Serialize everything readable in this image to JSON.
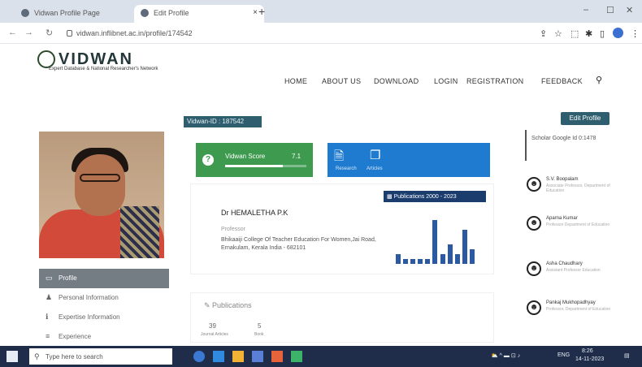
{
  "browser": {
    "tabs": [
      {
        "title": "Vidwan Profile Page",
        "active": false
      },
      {
        "title": "Edit Profile",
        "active": true
      }
    ],
    "new_tab_icon": "plus-icon",
    "url": "vidwan.inflibnet.ac.in/profile/174542"
  },
  "site": {
    "logo_text": "VIDWAN",
    "tagline": "Expert Database & National Researcher's Network",
    "menu": [
      "HOME",
      "ABOUT US",
      "DOWNLOAD",
      "LOGIN",
      "REGISTRATION",
      "FEEDBACK"
    ],
    "search_icon": "search-icon"
  },
  "profile": {
    "vidwan_id": "Vidwan-ID : 187542",
    "edit_label": "Edit Profile",
    "name": "Dr HEMALETHA P.K",
    "designation": "Professor",
    "address": "Bhikaaiji College Of Teacher Education For Women,Jai Road, Ernakulam, Kerala India - 682101",
    "vidwan_score_label": "Vidwan Score",
    "vidwan_score": "7.1",
    "vidwan_score_fraction": 0.71,
    "doc_stats": [
      {
        "label": "Research"
      },
      {
        "label": "Articles"
      }
    ],
    "publications_badge": "Publications 2000 - 2023",
    "publication_bars": [
      2,
      1,
      1,
      1,
      1,
      9,
      2,
      4,
      2,
      7,
      3
    ]
  },
  "side_menu": [
    {
      "label": "Profile",
      "icon": "user-icon",
      "active": true
    },
    {
      "label": "Personal Information",
      "icon": "person-icon",
      "active": false
    },
    {
      "label": "Expertise Information",
      "icon": "info-icon",
      "active": false
    },
    {
      "label": "Experience",
      "icon": "list-icon",
      "active": false
    }
  ],
  "publications_panel": {
    "title": "Publications",
    "stats": [
      {
        "value": "39",
        "label": "Journal Articles"
      },
      {
        "value": "5",
        "label": "Book"
      }
    ]
  },
  "other_ids": "Scholar Google Id 0:1478",
  "peers": [
    {
      "name": "S.V. Boopalam",
      "desc": "Associate Professor, Department of Education"
    },
    {
      "name": "Aparna Kumar",
      "desc": "Professor Department of Education"
    },
    {
      "name": "Asha Chaudhary",
      "desc": "Assistant Professor Education"
    },
    {
      "name": "Pankaj Mukhopadhyay",
      "desc": "Professor, Department of Education"
    }
  ],
  "taskbar": {
    "search_placeholder": "Type here to search",
    "time": "8:26",
    "date": "14-11-2023",
    "lang": "ENG"
  },
  "colors": {
    "score_green": "#3d9a4f",
    "doc_blue": "#1e7bcf",
    "badge_teal": "#2f5f6e",
    "chart_blue": "#2b5aa3"
  }
}
